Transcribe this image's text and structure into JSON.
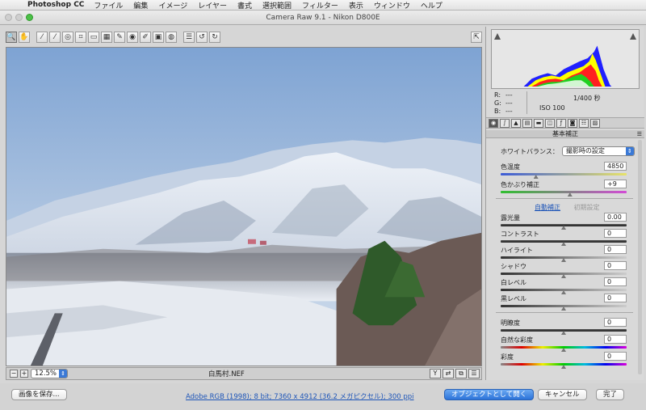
{
  "menubar": {
    "app": "Photoshop CC",
    "items": [
      "ファイル",
      "編集",
      "イメージ",
      "レイヤー",
      "書式",
      "選択範囲",
      "フィルター",
      "表示",
      "ウィンドウ",
      "ヘルプ"
    ]
  },
  "window": {
    "title": "Camera Raw 9.1  -  Nikon D800E"
  },
  "status": {
    "zoom": "12.5%",
    "filename": "白馬村.NEF"
  },
  "readout": {
    "r_label": "R:",
    "g_label": "G:",
    "b_label": "B:",
    "r_value": "---",
    "g_value": "---",
    "b_value": "---",
    "shutter": "1/400 秒",
    "iso": "ISO 100"
  },
  "panel": {
    "section_title": "基本補正",
    "white_balance_label": "ホワイトバランス：",
    "white_balance_value": "撮影時の設定",
    "auto_label": "自動補正",
    "default_label": "初期設定",
    "sliders": {
      "temperature": {
        "label": "色温度",
        "value": "4850",
        "level": 0.28
      },
      "tint": {
        "label": "色かぶり補正",
        "value": "+9",
        "level": 0.55
      },
      "exposure": {
        "label": "露光量",
        "value": "0.00",
        "level": 0.5
      },
      "contrast": {
        "label": "コントラスト",
        "value": "0",
        "level": 0.5
      },
      "highlights": {
        "label": "ハイライト",
        "value": "0",
        "level": 0.5
      },
      "shadows": {
        "label": "シャドウ",
        "value": "0",
        "level": 0.5
      },
      "whites": {
        "label": "白レベル",
        "value": "0",
        "level": 0.5
      },
      "blacks": {
        "label": "黒レベル",
        "value": "0",
        "level": 0.5
      },
      "clarity": {
        "label": "明瞭度",
        "value": "0",
        "level": 0.5
      },
      "vibrance": {
        "label": "自然な彩度",
        "value": "0",
        "level": 0.5
      },
      "saturation": {
        "label": "彩度",
        "value": "0",
        "level": 0.5
      }
    }
  },
  "bottom": {
    "save_label": "画像を保存...",
    "workflow_link": "Adobe RGB (1998); 8 bit; 7360 x 4912 (36.2 メガピクセル); 300 ppi",
    "open_label": "オブジェクトとして開く",
    "cancel_label": "キャンセル",
    "done_label": "完了"
  },
  "colors": {
    "accent": "#2c73d8",
    "link": "#1f56b8"
  }
}
